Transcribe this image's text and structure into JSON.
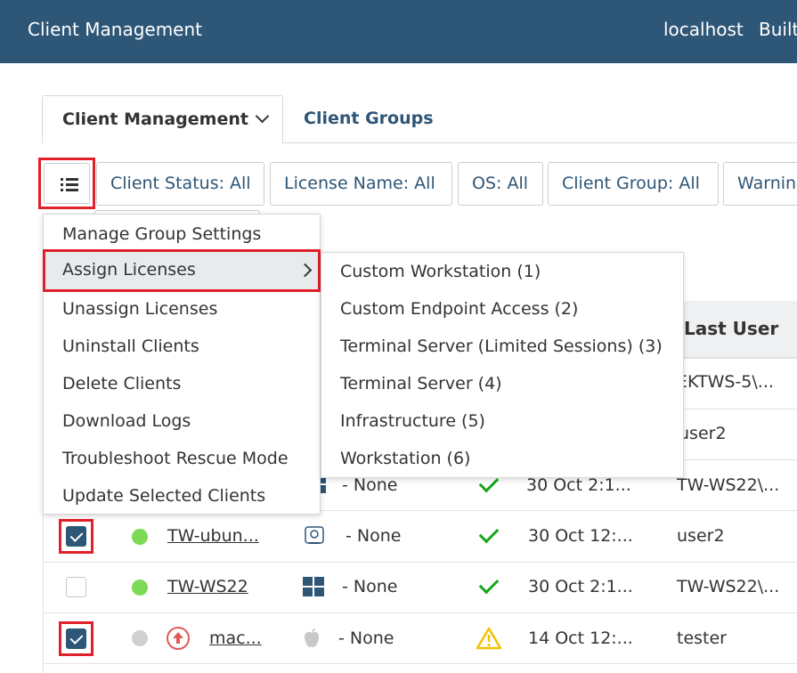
{
  "header": {
    "title": "Client Management",
    "host": "localhost",
    "user": "Built"
  },
  "tabs": [
    {
      "label": "Client Management"
    },
    {
      "label": "Client Groups"
    }
  ],
  "filters": [
    {
      "label": "Client Status: All"
    },
    {
      "label": "License Name: All"
    },
    {
      "label": "OS: All"
    },
    {
      "label": "Client Group: All"
    },
    {
      "label": "Warnin"
    }
  ],
  "menu": {
    "items": [
      "Manage Group Settings",
      "Assign Licenses",
      "Unassign Licenses",
      "Uninstall Clients",
      "Delete Clients",
      "Download Logs",
      "Troubleshoot Rescue Mode",
      "Update Selected Clients"
    ]
  },
  "submenu": {
    "items": [
      "Custom Workstation (1)",
      "Custom Endpoint Access (2)",
      "Terminal Server (Limited Sessions) (3)",
      "Terminal Server (4)",
      "Infrastructure (5)",
      "Workstation (6)"
    ]
  },
  "table": {
    "last_user_header": "Last User",
    "rows": [
      {
        "checked": false,
        "status": "",
        "name": "",
        "os": "",
        "license": "",
        "ok": "",
        "date": "",
        "last_user": "EKTWS-5\\..."
      },
      {
        "checked": false,
        "status": "",
        "name": "",
        "os": "",
        "license": "",
        "ok": "",
        "date": "",
        "last_user": "user2"
      },
      {
        "checked": false,
        "status": "",
        "name": "",
        "os": "windows",
        "license": "- None",
        "ok": "check",
        "date": "30 Oct 2:1...",
        "last_user": "TW-WS22\\..."
      },
      {
        "checked": true,
        "status": "online",
        "name": "TW-ubun...",
        "os": "linux",
        "license": "- None",
        "ok": "check",
        "date": "30 Oct 12:...",
        "last_user": "user2"
      },
      {
        "checked": false,
        "status": "online",
        "name": "TW-WS22",
        "os": "windows",
        "license": "- None",
        "ok": "check",
        "date": "30 Oct 2:1...",
        "last_user": "TW-WS22\\..."
      },
      {
        "checked": true,
        "status": "offline",
        "name": "mac...",
        "os": "apple",
        "license": "- None",
        "ok": "warning",
        "date": "14 Oct 12:...",
        "last_user": "tester"
      }
    ]
  },
  "colors": {
    "header_bg": "#2e5677",
    "accent": "#2e5677",
    "highlight": "#e0202a",
    "online": "#7ed957",
    "offline": "#d0d0d0",
    "ok": "#1aa51a",
    "warning": "#f2c200"
  }
}
